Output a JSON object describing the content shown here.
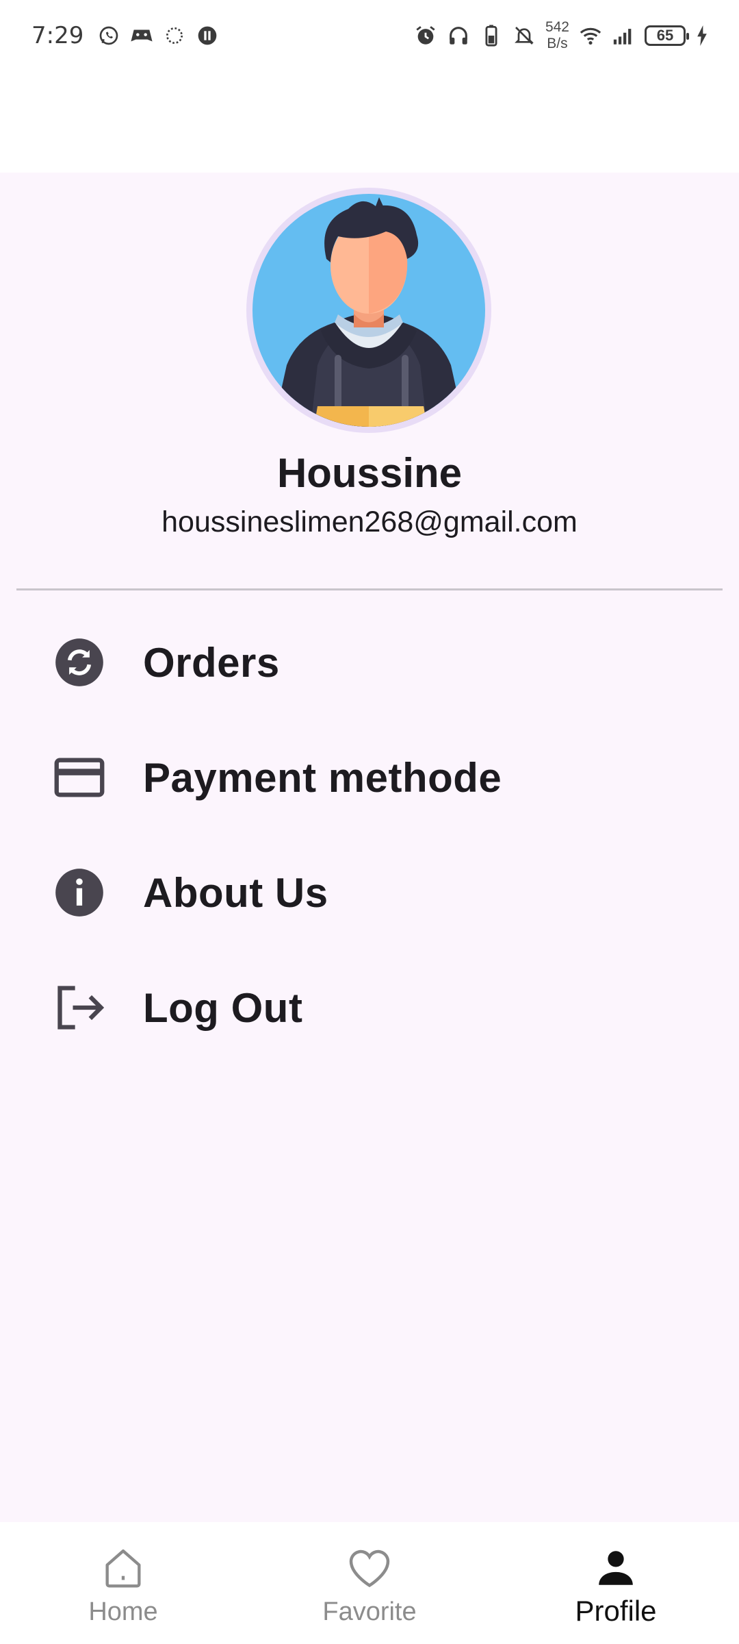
{
  "status_bar": {
    "time": "7:29",
    "net_speed_value": "542",
    "net_speed_unit": "B/s",
    "battery": "65",
    "left_icons": [
      "whatsapp-icon",
      "game-icon",
      "loading-icon",
      "pause-icon"
    ],
    "right_icons": [
      "alarm-icon",
      "headphones-icon",
      "battery-saver-icon",
      "mute-icon",
      "wifi-icon",
      "signal-icon",
      "charging-icon"
    ]
  },
  "profile": {
    "name": "Houssine",
    "email": "houssineslimen268@gmail.com"
  },
  "menu": [
    {
      "label": "Orders",
      "icon": "sync-circle-icon"
    },
    {
      "label": "Payment methode",
      "icon": "credit-card-icon"
    },
    {
      "label": "About Us",
      "icon": "info-circle-icon"
    },
    {
      "label": "Log Out",
      "icon": "logout-icon"
    }
  ],
  "nav": [
    {
      "label": "Home",
      "icon": "home-icon",
      "active": false
    },
    {
      "label": "Favorite",
      "icon": "heart-icon",
      "active": false
    },
    {
      "label": "Profile",
      "icon": "person-icon",
      "active": true
    }
  ],
  "colors": {
    "background": "#fcf5fd",
    "text": "#1d1b20",
    "icon": "#49454f",
    "divider": "#c9c5cc",
    "nav_inactive": "#8c8c8c"
  }
}
